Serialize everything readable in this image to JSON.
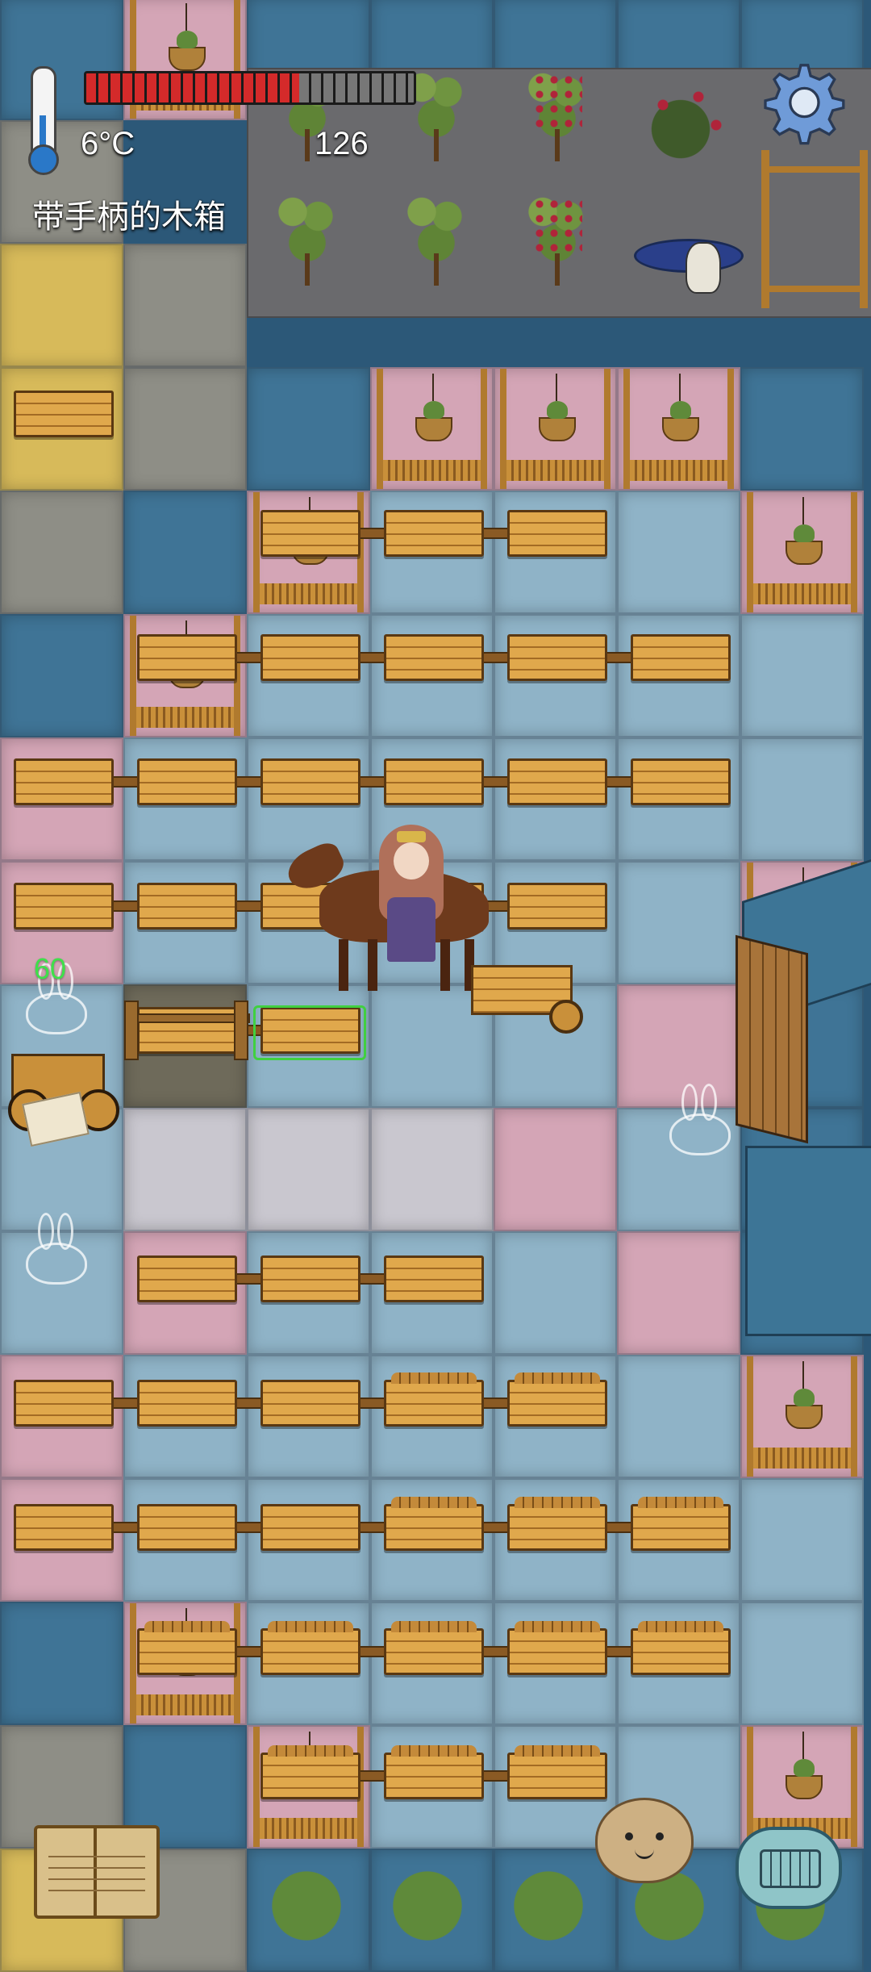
{
  "hud": {
    "temperature": "6°C",
    "health_fraction": 0.65,
    "hunger_value": "126",
    "held_item": "带手柄的木箱"
  },
  "world": {
    "floating_number": "60"
  },
  "icons": {
    "settings": "gear-icon",
    "journal": "book-icon",
    "emote": "potato-face-icon",
    "chat": "keyboard-icon",
    "temperature": "thermometer-icon"
  },
  "colors": {
    "health": "#d42a2a",
    "floating_number": "#3fe04a",
    "selection": "#40d040"
  }
}
